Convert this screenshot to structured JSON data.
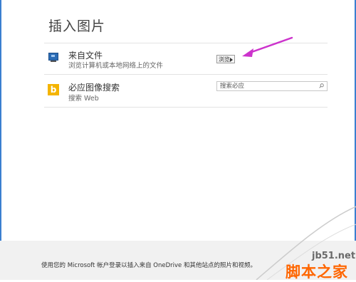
{
  "dialog": {
    "title": "插入图片"
  },
  "sources": [
    {
      "icon": "computer-icon",
      "label": "来自文件",
      "description": "浏览计算机或本地网络上的文件",
      "action_label": "浏览"
    },
    {
      "icon": "bing-icon",
      "label": "必应图像搜索",
      "description": "搜索 Web",
      "search_placeholder": "搜索必应"
    }
  ],
  "footer": {
    "text": "使用您的 Microsoft 帐户登录以插入来自 OneDrive 和其他站点的照片和视频。"
  },
  "watermark": {
    "site": "jb51.net",
    "name": "脚本之家"
  },
  "colors": {
    "accent_arrow": "#cc33cc",
    "bing_yellow": "#f4b400",
    "watermark_orange": "#ff6600"
  }
}
